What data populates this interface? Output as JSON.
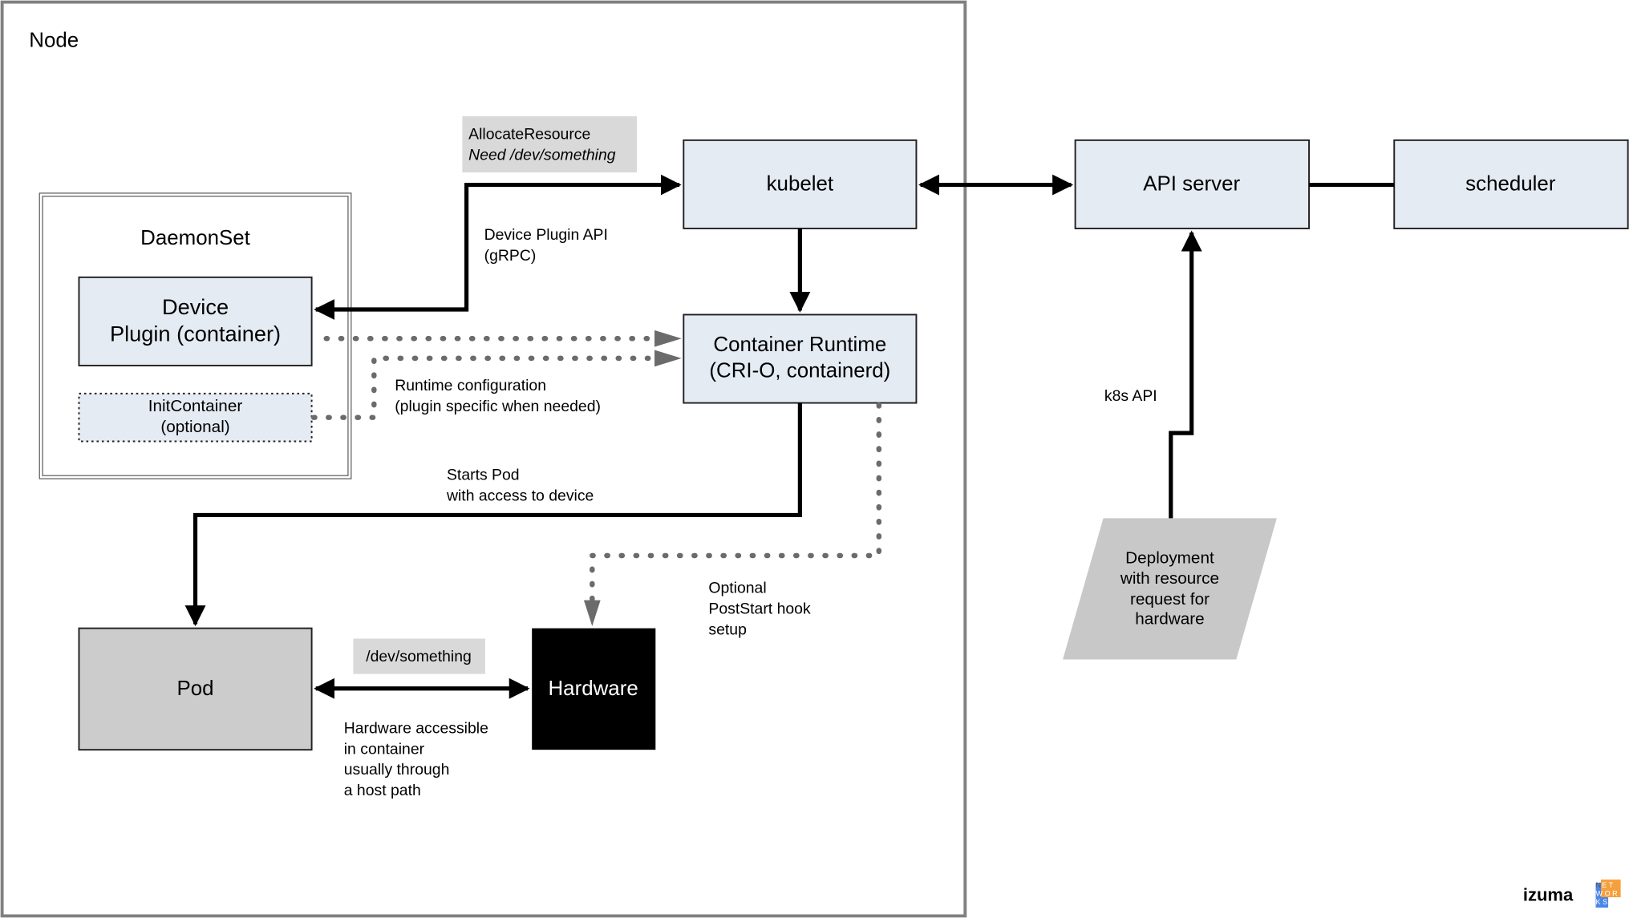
{
  "node": {
    "title": "Node"
  },
  "daemonset": {
    "title": "DaemonSet",
    "device_plugin": [
      "Device",
      "Plugin (container)"
    ],
    "init_container": [
      "InitContainer",
      "(optional)"
    ]
  },
  "allocate_label": {
    "line1": "AllocateResource",
    "line2": "Need /dev/something"
  },
  "kubelet": {
    "label": "kubelet"
  },
  "api_server": {
    "label": "API server"
  },
  "scheduler": {
    "label": "scheduler"
  },
  "container_runtime": {
    "lines": [
      "Container Runtime",
      "(CRI-O, containerd)"
    ]
  },
  "pod": {
    "label": "Pod"
  },
  "hardware": {
    "label": "Hardware"
  },
  "dev_label": {
    "label": "/dev/something"
  },
  "deployment": {
    "lines": [
      "Deployment",
      "with resource",
      "request for",
      "hardware"
    ]
  },
  "annotations": {
    "device_plugin_api": [
      "Device Plugin API",
      "(gRPC)"
    ],
    "runtime_config": [
      "Runtime configuration",
      "(plugin specific when needed)"
    ],
    "starts_pod": [
      "Starts Pod",
      "with access to device"
    ],
    "poststart": [
      "Optional",
      "PostStart hook",
      "setup"
    ],
    "hardware_access": [
      "Hardware accessible",
      "in container",
      "usually through",
      "a host path"
    ],
    "k8s_api": "k8s API"
  },
  "logo": {
    "text": "izuma",
    "badge": "NETWORKS"
  },
  "colors": {
    "box_fill": "#e4ebf3",
    "label_fill": "#d9d9d9",
    "pod_fill": "#cccccc",
    "hardware_fill": "#000000",
    "dotted": "#6b6b6b",
    "node_border": "#808080"
  }
}
